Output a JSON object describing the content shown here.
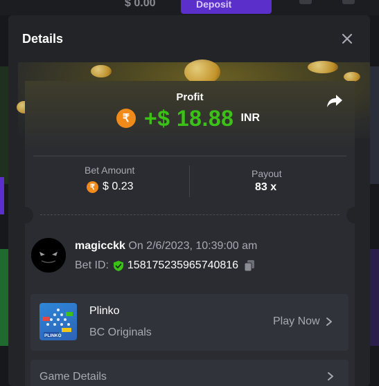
{
  "background": {
    "balance": "$ 0.00",
    "deposit_label": "Deposit"
  },
  "modal": {
    "title": "Details",
    "close_icon": "close-icon",
    "share_icon": "share-icon"
  },
  "profit": {
    "label": "Profit",
    "value": "+$ 18.88",
    "currency": "INR",
    "coin_symbol": "₹",
    "color": "#3bc117"
  },
  "bet": {
    "amount_label": "Bet Amount",
    "amount_value": "$ 0.23",
    "payout_label": "Payout",
    "payout_value": "83 x"
  },
  "user": {
    "name": "magicckk",
    "datetime": "On 2/6/2023, 10:39:00 am",
    "bet_id_label": "Bet ID:",
    "bet_id": "158175235965740816"
  },
  "game": {
    "name": "Plinko",
    "provider": "BC Originals",
    "play_label": "Play Now",
    "thumb_label": "PLINKO"
  },
  "details": {
    "label": "Game Details"
  },
  "colors": {
    "accent_green": "#3bc117",
    "coin_orange": "#f08a1a",
    "modal_bg": "#232428",
    "row_bg": "#31333a"
  }
}
